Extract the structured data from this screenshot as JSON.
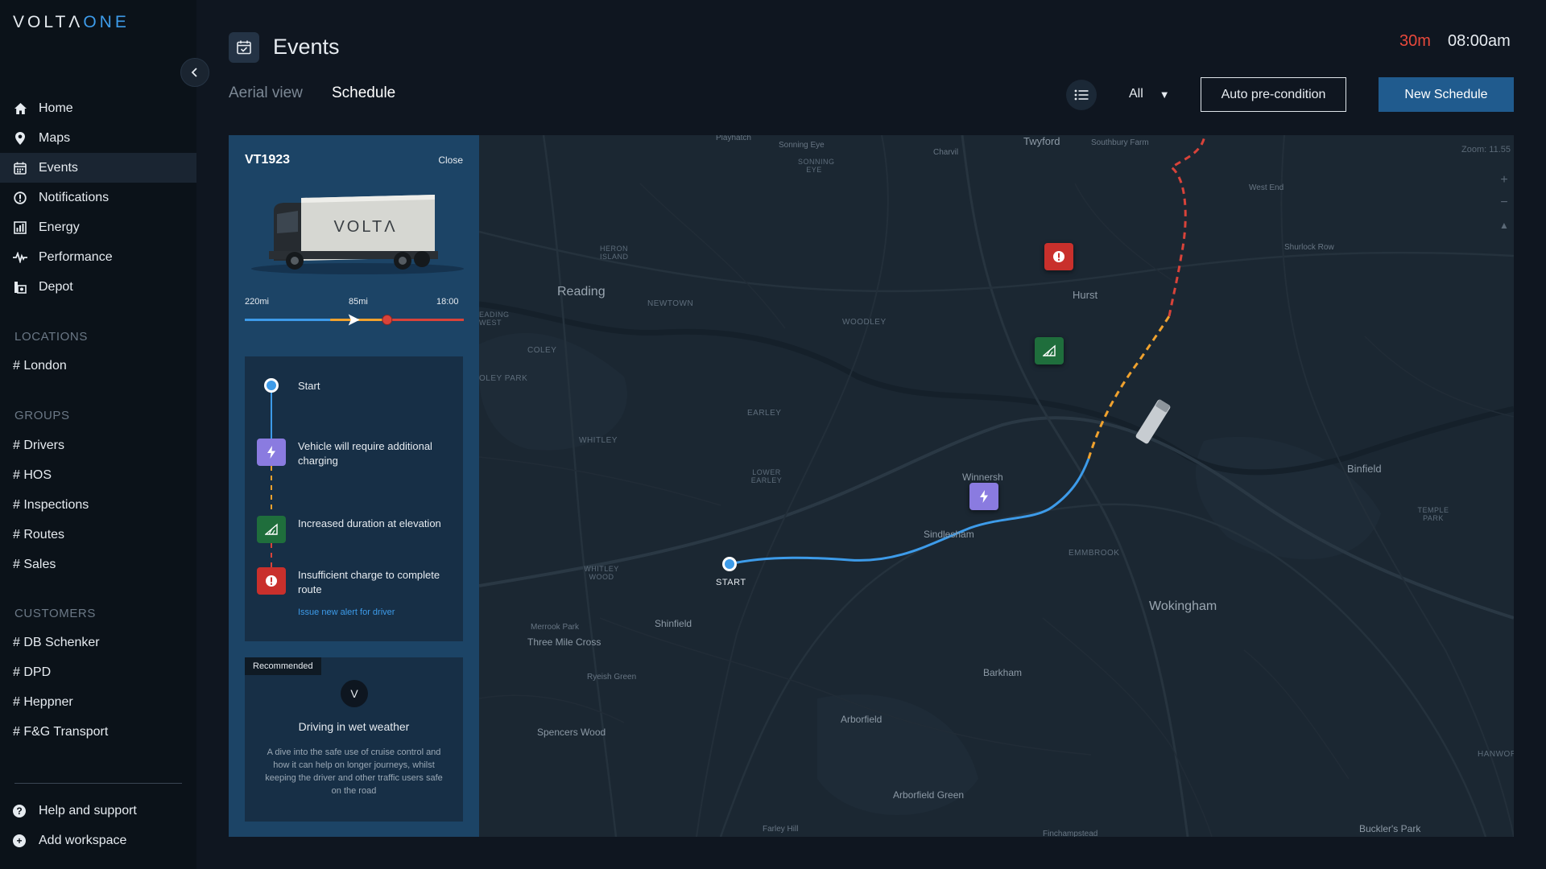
{
  "brand": {
    "name_main": "VOLTΛ",
    "name_accent": "ONE"
  },
  "nav": [
    {
      "label": "Home",
      "icon": "home-icon"
    },
    {
      "label": "Maps",
      "icon": "map-pin-icon"
    },
    {
      "label": "Events",
      "icon": "calendar-icon",
      "active": true
    },
    {
      "label": "Notifications",
      "icon": "alert-circle-icon"
    },
    {
      "label": "Energy",
      "icon": "energy-chart-icon"
    },
    {
      "label": "Performance",
      "icon": "pulse-icon"
    },
    {
      "label": "Depot",
      "icon": "depot-icon"
    }
  ],
  "sections": {
    "locations": {
      "title": "LOCATIONS",
      "items": [
        "# London"
      ]
    },
    "groups": {
      "title": "GROUPS",
      "items": [
        "# Drivers",
        "# HOS",
        "# Inspections",
        "# Routes",
        "# Sales"
      ]
    },
    "customers": {
      "title": "CUSTOMERS",
      "items": [
        "# DB Schenker",
        "# DPD",
        "# Heppner",
        "# F&G Transport"
      ]
    }
  },
  "footer": {
    "help": "Help and support",
    "add": "Add workspace"
  },
  "header": {
    "title": "Events",
    "delay": "30m",
    "time": "08:00am"
  },
  "tabs": {
    "aerial": "Aerial view",
    "schedule": "Schedule"
  },
  "toolbar": {
    "filter": "All",
    "auto_label": "Auto pre-condition",
    "new_label": "New Schedule"
  },
  "vehicle": {
    "id": "VT1923",
    "close": "Close",
    "truck_brand": "VOLTΛ",
    "range_start": "220mi",
    "range_mid": "85mi",
    "range_end": "18:00",
    "progress": 0.51,
    "warning_point": 0.65
  },
  "timeline": {
    "start": "Start",
    "charge": "Vehicle will require additional charging",
    "elevation": "Increased duration at elevation",
    "insufficient": "Insufficient charge to complete route",
    "link": "Issue new alert for driver"
  },
  "recommended": {
    "badge": "Recommended",
    "icon_letter": "V",
    "title": "Driving in wet weather",
    "desc": "A dive into the safe use of cruise control and how it can help on longer journeys, whilst keeping the driver and other traffic users safe on the road"
  },
  "map": {
    "zoom": "Zoom: 11.55",
    "start_label": "START",
    "labels": {
      "twyford": "Twyford",
      "reading": "Reading",
      "newtown": "NEWTOWN",
      "woodley": "WOODLEY",
      "hurst": "Hurst",
      "earley": "EARLEY",
      "whitley": "WHITLEY",
      "lower_earley": "LOWER EARLEY",
      "winnersh": "Winnersh",
      "sindlesham": "Sindlesham",
      "emmbrook": "EMMBROOK",
      "wokingham": "Wokingham",
      "binfield": "Binfield",
      "temple_park": "TEMPLE PARK",
      "shinfield": "Shinfield",
      "three_mile_cross": "Three Mile Cross",
      "whitley_wood": "WHITLEY WOOD",
      "barkham": "Barkham",
      "arborfield": "Arborfield",
      "arborfield_green": "Arborfield Green",
      "spencers_wood": "Spencers Wood",
      "coley": "COLEY",
      "coley_park": "OLEY PARK",
      "reading_west": "EADING WEST",
      "heron_island": "HERON ISLAND",
      "sonning_eye": "SONNING EYE",
      "west_end": "West End",
      "shurlock_row": "Shurlock Row",
      "hanwor": "HANWOR",
      "buckler": "Buckler's Park",
      "charvil": "Charvil",
      "playhatch": "Playhatch",
      "sonning_eye_sm": "Sonning Eye",
      "southbury": "Southbury Farm",
      "merrook": "Merrook Park",
      "ryeish": "Ryeish Green",
      "farley": "Farley Hill",
      "finchampstead": "Finchampstead"
    }
  }
}
